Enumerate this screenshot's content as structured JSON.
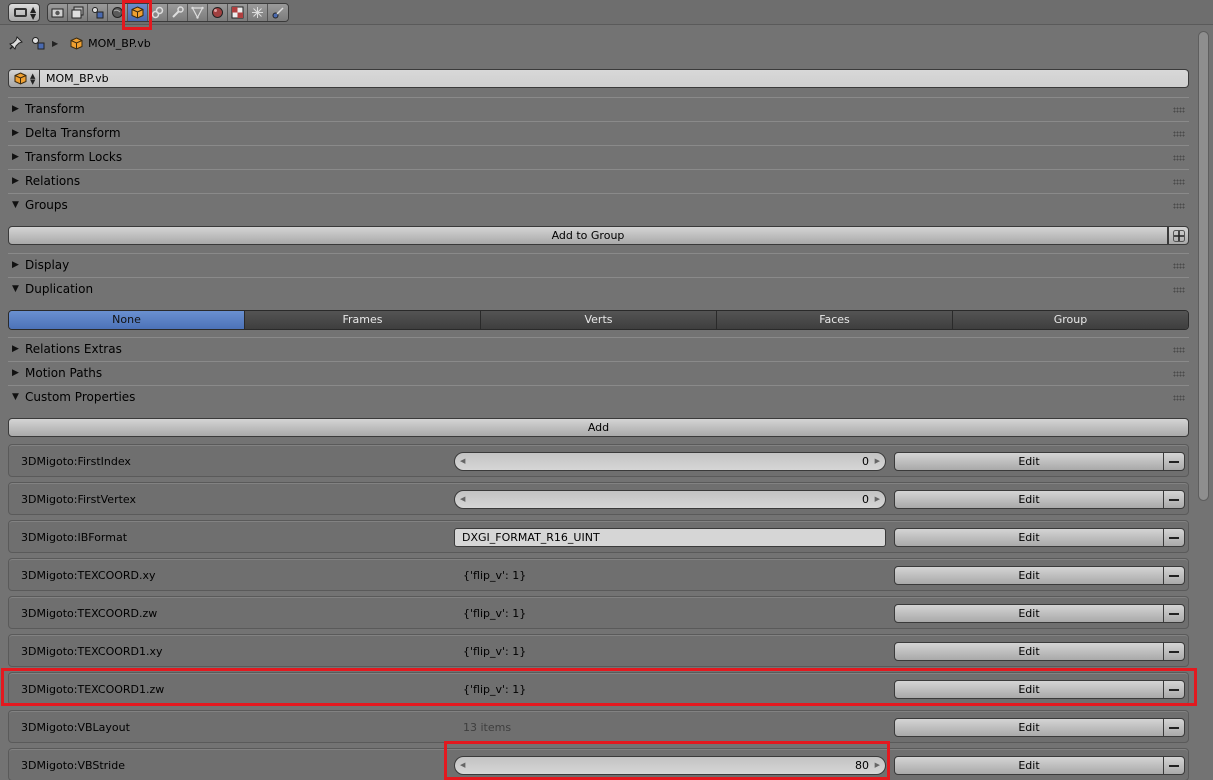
{
  "header": {
    "editor_type_icon": "properties-editor-icon",
    "context_tabs": [
      {
        "icon": "render-icon",
        "active": false
      },
      {
        "icon": "render-layers-icon",
        "active": false
      },
      {
        "icon": "scene-icon",
        "active": false
      },
      {
        "icon": "world-icon",
        "active": false
      },
      {
        "icon": "object-icon",
        "active": true
      },
      {
        "icon": "constraints-icon",
        "active": false
      },
      {
        "icon": "modifiers-icon",
        "active": false
      },
      {
        "icon": "mesh-data-icon",
        "active": false
      },
      {
        "icon": "material-icon",
        "active": false
      },
      {
        "icon": "texture-icon",
        "active": false
      },
      {
        "icon": "particles-icon",
        "active": false
      },
      {
        "icon": "physics-icon",
        "active": false
      }
    ]
  },
  "breadcrumb": {
    "object_name": "MOM_BP.vb"
  },
  "object_field": {
    "value": "MOM_BP.vb"
  },
  "panels": {
    "transform": {
      "title": "Transform",
      "expanded": false
    },
    "delta_transform": {
      "title": "Delta Transform",
      "expanded": false
    },
    "transform_locks": {
      "title": "Transform Locks",
      "expanded": false
    },
    "relations": {
      "title": "Relations",
      "expanded": false
    },
    "groups": {
      "title": "Groups",
      "expanded": true,
      "add_button": "Add to Group"
    },
    "display": {
      "title": "Display",
      "expanded": false
    },
    "duplication": {
      "title": "Duplication",
      "expanded": true,
      "options": [
        "None",
        "Frames",
        "Verts",
        "Faces",
        "Group"
      ],
      "selected": "None"
    },
    "relations_extras": {
      "title": "Relations Extras",
      "expanded": false
    },
    "motion_paths": {
      "title": "Motion Paths",
      "expanded": false
    },
    "custom_properties": {
      "title": "Custom Properties",
      "expanded": true,
      "add_button": "Add",
      "edit_label": "Edit"
    }
  },
  "custom_properties": [
    {
      "name": "3DMigoto:FirstIndex",
      "kind": "slider",
      "value": "0"
    },
    {
      "name": "3DMigoto:FirstVertex",
      "kind": "slider",
      "value": "0"
    },
    {
      "name": "3DMigoto:IBFormat",
      "kind": "text",
      "value": "DXGI_FORMAT_R16_UINT"
    },
    {
      "name": "3DMigoto:TEXCOORD.xy",
      "kind": "static",
      "value": "{'flip_v': 1}"
    },
    {
      "name": "3DMigoto:TEXCOORD.zw",
      "kind": "static",
      "value": "{'flip_v': 1}"
    },
    {
      "name": "3DMigoto:TEXCOORD1.xy",
      "kind": "static",
      "value": "{'flip_v': 1}"
    },
    {
      "name": "3DMigoto:TEXCOORD1.zw",
      "kind": "static",
      "value": "{'flip_v': 1}"
    },
    {
      "name": "3DMigoto:VBLayout",
      "kind": "static",
      "value": "13 items"
    },
    {
      "name": "3DMigoto:VBStride",
      "kind": "slider",
      "value": "80"
    }
  ],
  "colors": {
    "background": "#737373",
    "highlight": "#e3191f",
    "active_blue": "#5a80c4"
  }
}
